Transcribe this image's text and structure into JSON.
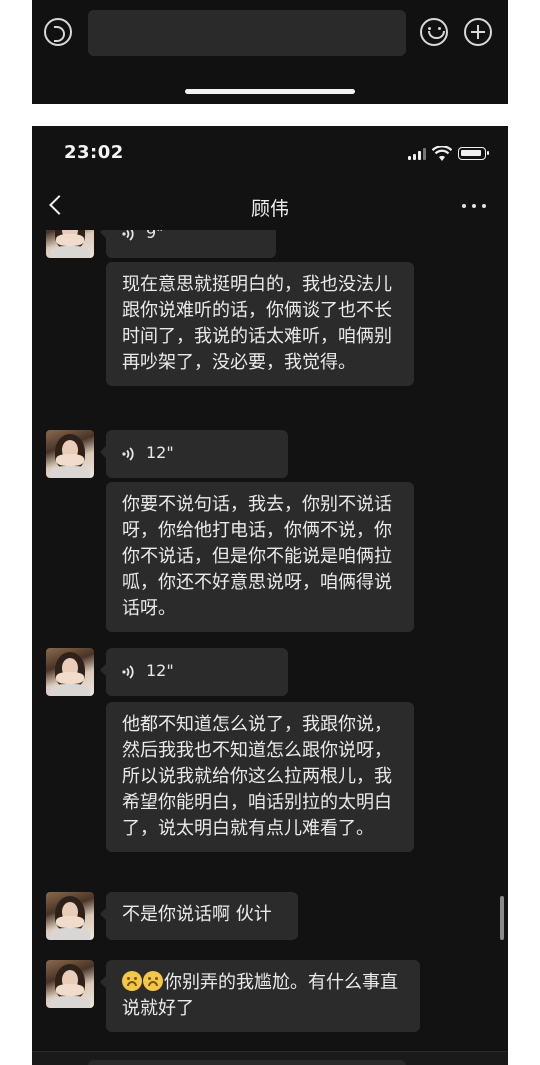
{
  "status_bar": {
    "time": "23:02"
  },
  "nav": {
    "title": "顾伟"
  },
  "messages": [
    {
      "type": "voice",
      "duration": "9\""
    },
    {
      "type": "text",
      "text": "现在意思就挺明白的，我也没法儿跟你说难听的话，你俩谈了也不长时间了，我说的话太难听，咱俩别再吵架了，没必要，我觉得。"
    },
    {
      "type": "voice",
      "duration": "12\""
    },
    {
      "type": "text",
      "text": "你要不说句话，我去，你别不说话呀，你给他打电话，你俩不说，你你不说话，但是你不能说是咱俩拉呱，你还不好意思说呀，咱俩得说话呀。"
    },
    {
      "type": "voice",
      "duration": "12\""
    },
    {
      "type": "text",
      "text": "他都不知道怎么说了，我跟你说，然后我我也不知道怎么跟你说呀，所以说我就给你这么拉两根儿，我希望你能明白，咱话别拉的太明白了，说太明白就有点儿难看了。"
    },
    {
      "type": "text",
      "text": "不是你说话啊 伙计"
    },
    {
      "type": "text",
      "text": "你别弄的我尴尬。有什么事直说就好了",
      "emoji_prefix": "grin-sweat-emoji x2"
    }
  ]
}
